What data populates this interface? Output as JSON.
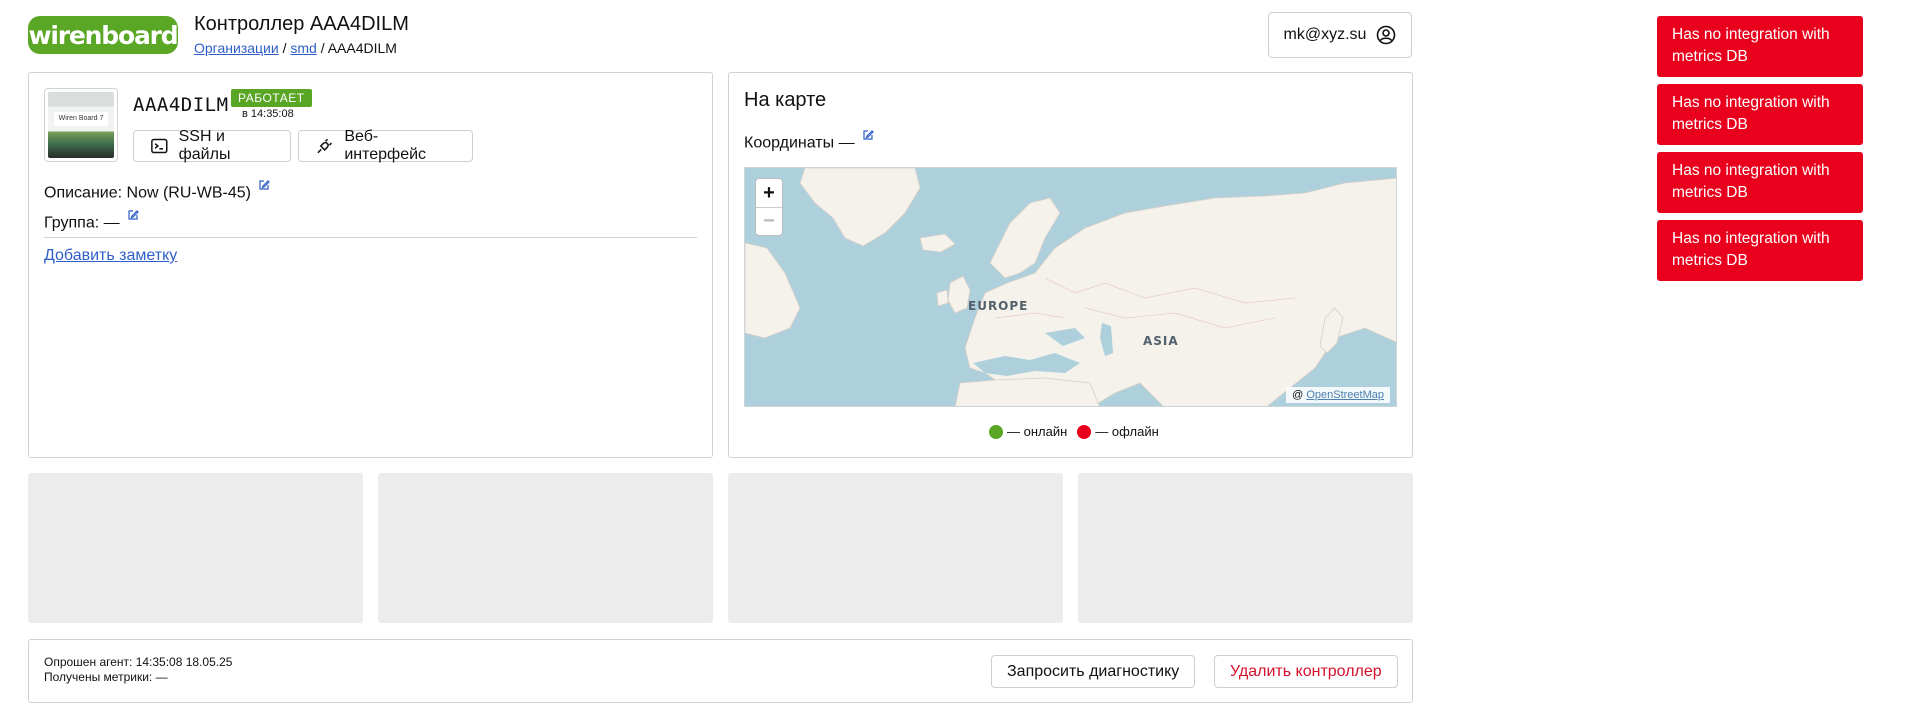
{
  "header": {
    "logo_text": "wirenboard",
    "title": "Контроллер AAA4DILM",
    "breadcrumb": {
      "org": "Организации",
      "sep1": "/",
      "group": "smd",
      "sep2": "/",
      "current": "AAA4DILM"
    },
    "user_email": "mk@xyz.su",
    "user_icon": "user-circle-icon"
  },
  "device": {
    "image_label": "Wiren Board 7",
    "name": "AAA4DILM",
    "status": "РАБОТАЕТ",
    "status_time": "в 14:35:08",
    "status_color": "#58a624",
    "ssh_label": "SSH и файлы",
    "web_label": "Веб-интерфейс",
    "description_label": "Описание:",
    "description_value": "Now (RU-WB-45)",
    "group_label": "Группа:",
    "group_value": "—",
    "add_note": "Добавить заметку"
  },
  "map": {
    "title": "На карте",
    "coords_label": "Координаты",
    "coords_value": "—",
    "zoom_in": "+",
    "zoom_out": "−",
    "label_europe": "EUROPE",
    "label_asia": "ASIA",
    "attribution_prefix": "@",
    "attribution_link": "OpenStreetMap",
    "legend_online": "— онлайн",
    "legend_offline": "— офлайн",
    "online_color": "#58a624",
    "offline_color": "#e8001c"
  },
  "footer": {
    "agent_polled": "Опрошен агент: 14:35:08 18.05.25",
    "metrics_received": "Получены метрики: —",
    "diag_button": "Запросить диагностику",
    "delete_button": "Удалить контроллер"
  },
  "toasts": [
    {
      "text": "Has no integration with metrics DB"
    },
    {
      "text": "Has no integration with metrics DB"
    },
    {
      "text": "Has no integration with metrics DB"
    },
    {
      "text": "Has no integration with metrics DB"
    }
  ],
  "colors": {
    "brand": "#5aa625",
    "link": "#2f5ec9",
    "danger": "#e8001c"
  }
}
